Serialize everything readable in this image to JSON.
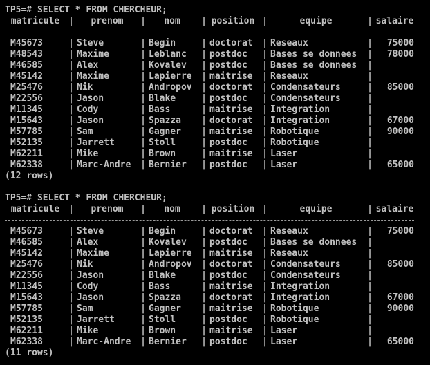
{
  "terminal": {
    "foreground": "#c0c0c0",
    "background": "#000000",
    "queries": [
      {
        "prompt": "TP5=# SELECT * FROM CHERCHEUR;",
        "columns": [
          "matricule",
          "prenom",
          "nom",
          "position",
          "equipe",
          "salaire"
        ],
        "rows": [
          [
            "M45673",
            "Steve",
            "Begin",
            "doctorat",
            "Reseaux",
            "75000"
          ],
          [
            "M48543",
            "Maxime",
            "Leblanc",
            "postdoc",
            "Bases se donnees",
            "78000"
          ],
          [
            "M46585",
            "Alex",
            "Kovalev",
            "postdoc",
            "Bases se donnees",
            ""
          ],
          [
            "M45142",
            "Maxime",
            "Lapierre",
            "maitrise",
            "Reseaux",
            ""
          ],
          [
            "M25476",
            "Nik",
            "Andropov",
            "doctorat",
            "Condensateurs",
            "85000"
          ],
          [
            "M22556",
            "Jason",
            "Blake",
            "postdoc",
            "Condensateurs",
            ""
          ],
          [
            "M11345",
            "Cody",
            "Bass",
            "maitrise",
            "Integration",
            ""
          ],
          [
            "M15643",
            "Jason",
            "Spazza",
            "doctorat",
            "Integration",
            "67000"
          ],
          [
            "M57785",
            "Sam",
            "Gagner",
            "maitrise",
            "Robotique",
            "90000"
          ],
          [
            "M52135",
            "Jarrett",
            "Stoll",
            "postdoc",
            "Robotique",
            ""
          ],
          [
            "M62211",
            "Mike",
            "Brown",
            "maitrise",
            "Laser",
            ""
          ],
          [
            "M62338",
            "Marc-Andre",
            "Bernier",
            "postdoc",
            "Laser",
            "65000"
          ]
        ],
        "footer": "(12 rows)"
      },
      {
        "prompt": "TP5=# SELECT * FROM CHERCHEUR;",
        "columns": [
          "matricule",
          "prenom",
          "nom",
          "position",
          "equipe",
          "salaire"
        ],
        "rows": [
          [
            "M45673",
            "Steve",
            "Begin",
            "doctorat",
            "Reseaux",
            "75000"
          ],
          [
            "M46585",
            "Alex",
            "Kovalev",
            "postdoc",
            "Bases se donnees",
            ""
          ],
          [
            "M45142",
            "Maxime",
            "Lapierre",
            "maitrise",
            "Reseaux",
            ""
          ],
          [
            "M25476",
            "Nik",
            "Andropov",
            "doctorat",
            "Condensateurs",
            "85000"
          ],
          [
            "M22556",
            "Jason",
            "Blake",
            "postdoc",
            "Condensateurs",
            ""
          ],
          [
            "M11345",
            "Cody",
            "Bass",
            "maitrise",
            "Integration",
            ""
          ],
          [
            "M15643",
            "Jason",
            "Spazza",
            "doctorat",
            "Integration",
            "67000"
          ],
          [
            "M57785",
            "Sam",
            "Gagner",
            "maitrise",
            "Robotique",
            "90000"
          ],
          [
            "M52135",
            "Jarrett",
            "Stoll",
            "postdoc",
            "Robotique",
            ""
          ],
          [
            "M62211",
            "Mike",
            "Brown",
            "maitrise",
            "Laser",
            ""
          ],
          [
            "M62338",
            "Marc-Andre",
            "Bernier",
            "postdoc",
            "Laser",
            "65000"
          ]
        ],
        "footer": "(11 rows)"
      }
    ]
  }
}
